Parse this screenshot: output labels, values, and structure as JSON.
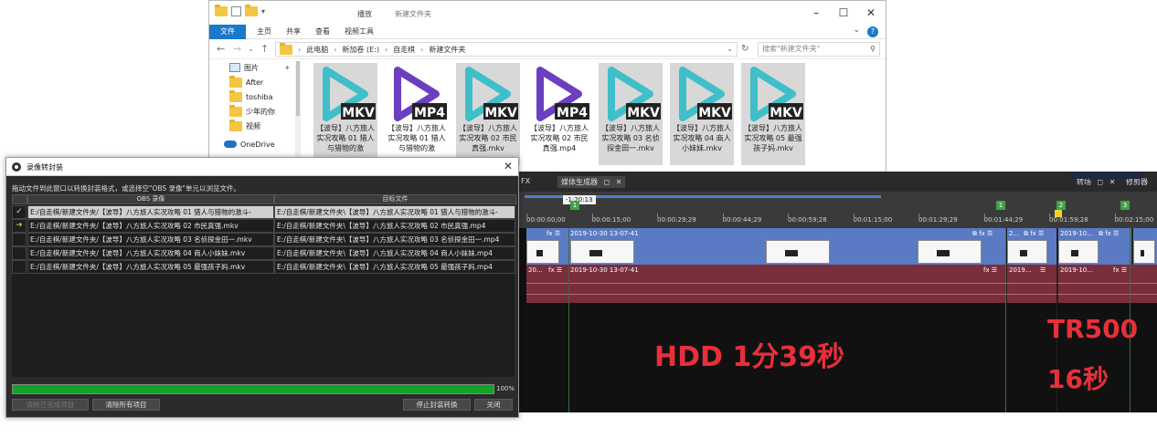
{
  "explorer": {
    "title": "新建文件夹",
    "context_tab": "播放",
    "ribbon_tabs": [
      "文件",
      "主页",
      "共享",
      "查看",
      "视频工具"
    ],
    "breadcrumb": [
      "此电脑",
      "新加卷 (E:)",
      "自走棋",
      "新建文件夹"
    ],
    "search_placeholder": "搜索\"新建文件夹\"",
    "nav_items": [
      "图片",
      "After",
      "toshiba",
      "少年的你",
      "视频",
      "OneDrive"
    ],
    "files": [
      {
        "type": "MKV",
        "name": "【波导】八方旅人实况攻略 01 猎人与猎物的激",
        "color": "#3fbfc9",
        "selected": true
      },
      {
        "type": "MP4",
        "name": "【波导】八方旅人实况攻略 01 猎人与猎物的激",
        "color": "#6b3fbf",
        "selected": false
      },
      {
        "type": "MKV",
        "name": "【波导】八方旅人实况攻略 02 市民真强.mkv",
        "color": "#3fbfc9",
        "selected": true
      },
      {
        "type": "MP4",
        "name": "【波导】八方旅人实况攻略 02 市民真强.mp4",
        "color": "#6b3fbf",
        "selected": false
      },
      {
        "type": "MKV",
        "name": "【波导】八方旅人实况攻略 03 名侦探金田一.mkv",
        "color": "#3fbfc9",
        "selected": true
      },
      {
        "type": "MKV",
        "name": "【波导】八方旅人实况攻略 04 商人小妹妹.mkv",
        "color": "#3fbfc9",
        "selected": true
      },
      {
        "type": "MKV",
        "name": "【波导】八方旅人实况攻略 05 最强孩子妈.mkv",
        "color": "#3fbfc9",
        "selected": true
      }
    ]
  },
  "vegas": {
    "tab_fx": "FX",
    "tab_media_generator": "媒体生成器",
    "tab_transitions": "转场",
    "tab_trimmer": "修剪器",
    "cursor_time": "-1:20:13",
    "ruler_ticks": [
      "00:00:00;00",
      "00:00:15;00",
      "00:00:29;29",
      "00:00:44;29",
      "00:00:59;28",
      "00:01:15;00",
      "00:01:29;29",
      "00:01:44;29",
      "00:01:59;28",
      "00:02:15;00"
    ],
    "markers": [
      "1",
      "2",
      "1",
      "2",
      "3"
    ],
    "clip_date": "2019-10-30 13-07-41",
    "clip_short_a": "20...",
    "clip_short_b": "2019...",
    "clip_short_c": "2019-10...",
    "clip_short_d": "2019-10...",
    "clip_short_e": "2...",
    "overlay_hdd": "HDD 1分39秒",
    "overlay_tr500": "TR500",
    "overlay_16s": "16秒",
    "colors": {
      "video_track": "#5a7bc4",
      "audio_track": "#7a2e3c",
      "overlay": "#e8303a"
    }
  },
  "remux": {
    "title": "录像转封装",
    "instruction": "拖动文件到此窗口以转换封装格式，或选择空\"OBS 录像\"单元以浏览文件。",
    "col_source": "OBS 录像",
    "col_target": "目标文件",
    "rows": [
      {
        "status": "✓",
        "source": "E:/自走棋/新建文件夹/【波导】八方旅人实况攻略 01 猎人与猎物的激斗-",
        "target": "E:/自走棋/新建文件夹\\【波导】八方旅人实况攻略 01 猎人与猎物的激斗-"
      },
      {
        "status": "➜",
        "source": "E:/自走棋/新建文件夹/【波导】八方旅人实况攻略 02 市民真强.mkv",
        "target": "E:/自走棋/新建文件夹\\【波导】八方旅人实况攻略 02 市民真强.mp4"
      },
      {
        "status": "",
        "source": "E:/自走棋/新建文件夹/【波导】八方旅人实况攻略 03 名侦探金田一.mkv",
        "target": "E:/自走棋/新建文件夹\\【波导】八方旅人实况攻略 03 名侦探金田一.mp4"
      },
      {
        "status": "",
        "source": "E:/自走棋/新建文件夹/【波导】八方旅人实况攻略 04 商人小妹妹.mkv",
        "target": "E:/自走棋/新建文件夹\\【波导】八方旅人实况攻略 04 商人小妹妹.mp4"
      },
      {
        "status": "",
        "source": "E:/自走棋/新建文件夹/【波导】八方旅人实况攻略 05 最强孩子妈.mkv",
        "target": "E:/自走棋/新建文件夹\\【波导】八方旅人实况攻略 05 最强孩子妈.mp4"
      }
    ],
    "progress_percent": 100,
    "progress_label": "100%",
    "buttons": {
      "clear_finished": "清除已完成项目",
      "clear_all": "清除所有项目",
      "stop": "停止封装转换",
      "close": "关闭"
    },
    "colors": {
      "progress": "#13a327"
    }
  }
}
